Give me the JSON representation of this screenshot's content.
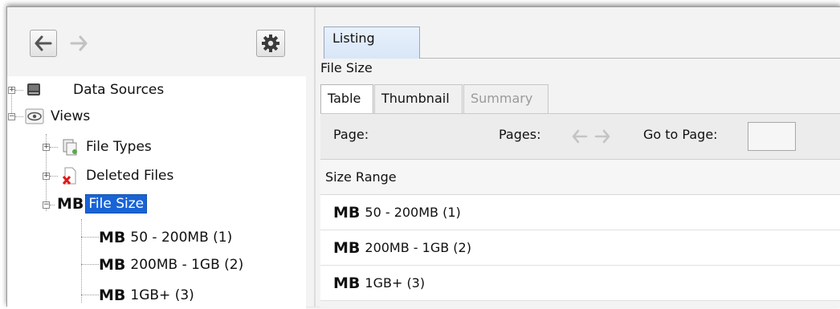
{
  "toolbar": {
    "back_icon": "arrow-left-icon",
    "forward_icon": "arrow-right-icon",
    "settings_icon": "gear-icon"
  },
  "tree": {
    "data_sources": {
      "label": "Data Sources",
      "icon": "disk-icon"
    },
    "views": {
      "label": "Views",
      "icon": "eye-icon"
    },
    "file_types": {
      "label": "File Types",
      "icon": "file-types-icon"
    },
    "deleted_files": {
      "label": "Deleted Files",
      "icon": "deleted-file-icon"
    },
    "file_size": {
      "label": "File Size",
      "badge": "MB",
      "children": [
        {
          "badge": "MB",
          "label": "50 - 200MB (1)"
        },
        {
          "badge": "MB",
          "label": "200MB - 1GB (2)"
        },
        {
          "badge": "MB",
          "label": "1GB+ (3)"
        }
      ]
    },
    "selected_color": "#1864d6"
  },
  "right": {
    "top_tab": "Listing",
    "title": "File Size",
    "sub_tabs": [
      {
        "label": "Table",
        "state": "active"
      },
      {
        "label": "Thumbnail",
        "state": "normal"
      },
      {
        "label": "Summary",
        "state": "disabled"
      }
    ],
    "pager": {
      "page_label": "Page:",
      "pages_label": "Pages:",
      "goto_label": "Go to Page:",
      "goto_value": ""
    },
    "table": {
      "header": "Size Range",
      "rows": [
        {
          "badge": "MB",
          "label": "50 - 200MB (1)"
        },
        {
          "badge": "MB",
          "label": "200MB - 1GB (2)"
        },
        {
          "badge": "MB",
          "label": "1GB+ (3)"
        }
      ]
    }
  }
}
